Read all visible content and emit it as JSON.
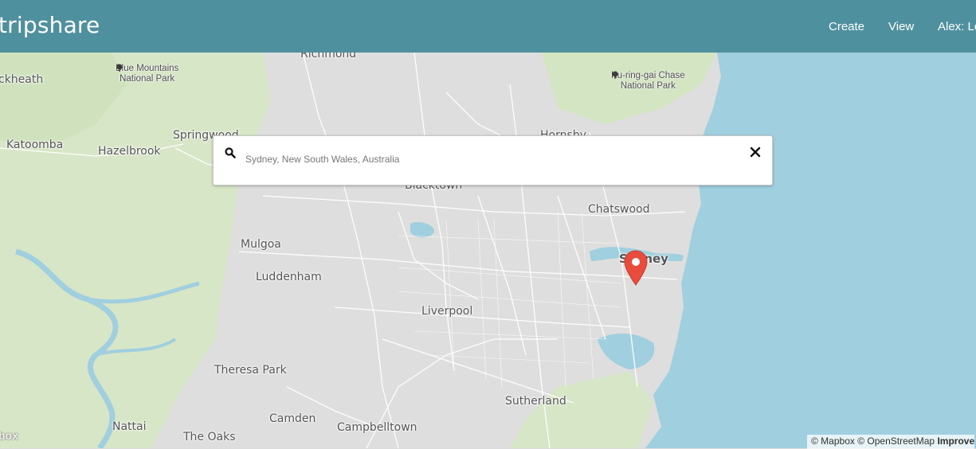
{
  "navbar": {
    "brand": "tripshare",
    "links": {
      "create": "Create",
      "view": "View",
      "user": "Alex: Lo"
    },
    "color": "#4f909e"
  },
  "search": {
    "placeholder": "Sydney, New South Wales, Australia",
    "search_icon": "search-icon",
    "clear_icon": "close-icon"
  },
  "map": {
    "towns": {
      "richmond": "Richmond",
      "blackheath": "ckheath",
      "katoomba": "Katoomba",
      "hazelbrook": "Hazelbrook",
      "springwood": "Springwood",
      "hornsby": "Hornsby",
      "blacktown": "Blacktown",
      "chatswood": "Chatswood",
      "mulgoa": "Mulgoa",
      "luddenham": "Luddenham",
      "liverpool": "Liverpool",
      "theresa_park": "Theresa Park",
      "sutherland": "Sutherland",
      "camden": "Camden",
      "campbelltown": "Campbelltown",
      "nattai": "Nattai",
      "the_oaks": "The Oaks",
      "sydney": "Sydney"
    },
    "parks": {
      "blue_mountains_1": "Blue Mountains",
      "blue_mountains_2": "National Park",
      "kuringgai_1": "Ku-ring-gai Chase",
      "kuringgai_2": "National Park"
    },
    "marker_icon": "map-pin-icon",
    "marker_color": "#e84c3d",
    "water_color": "#a0cfdf",
    "park_color": "#d8e8c8"
  },
  "attribution": {
    "mapbox": "© Mapbox",
    "osm": "© OpenStreetMap",
    "improve": "Improve",
    "logo": "box"
  }
}
